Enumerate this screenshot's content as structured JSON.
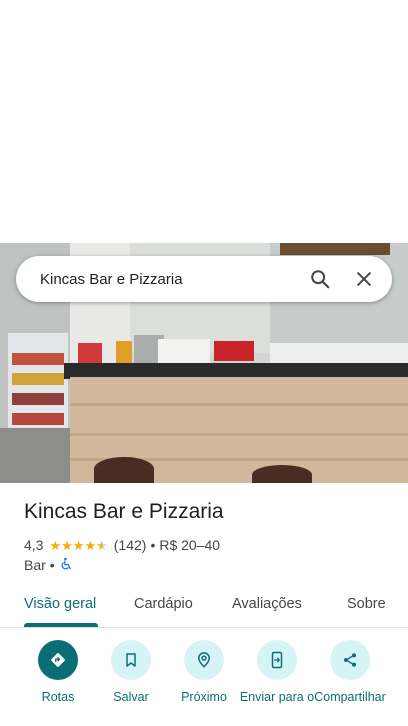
{
  "search": {
    "query": "Kincas Bar e Pizzaria"
  },
  "place": {
    "name": "Kincas Bar e Pizzaria",
    "rating": "4,3",
    "rating_value": 4.3,
    "reviews": "(142)",
    "separator": "•",
    "price": "R$ 20–40",
    "category": "Bar",
    "accessibility_icon": "wheelchair-icon"
  },
  "tabs": [
    {
      "label": "Visão geral",
      "active": true
    },
    {
      "label": "Cardápio"
    },
    {
      "label": "Avaliações"
    },
    {
      "label": "Sobre"
    }
  ],
  "actions": [
    {
      "label": "Rotas",
      "icon": "directions-icon"
    },
    {
      "label": "Salvar",
      "icon": "bookmark-icon"
    },
    {
      "label": "Próximo",
      "icon": "nearby-icon"
    },
    {
      "label": "Enviar para o",
      "icon": "send-to-phone-icon"
    },
    {
      "label": "Compartilhar",
      "icon": "share-icon"
    }
  ],
  "colors": {
    "accent": "#0b6e75",
    "accent_light": "#d6f3f6",
    "star": "#f9ab00"
  }
}
